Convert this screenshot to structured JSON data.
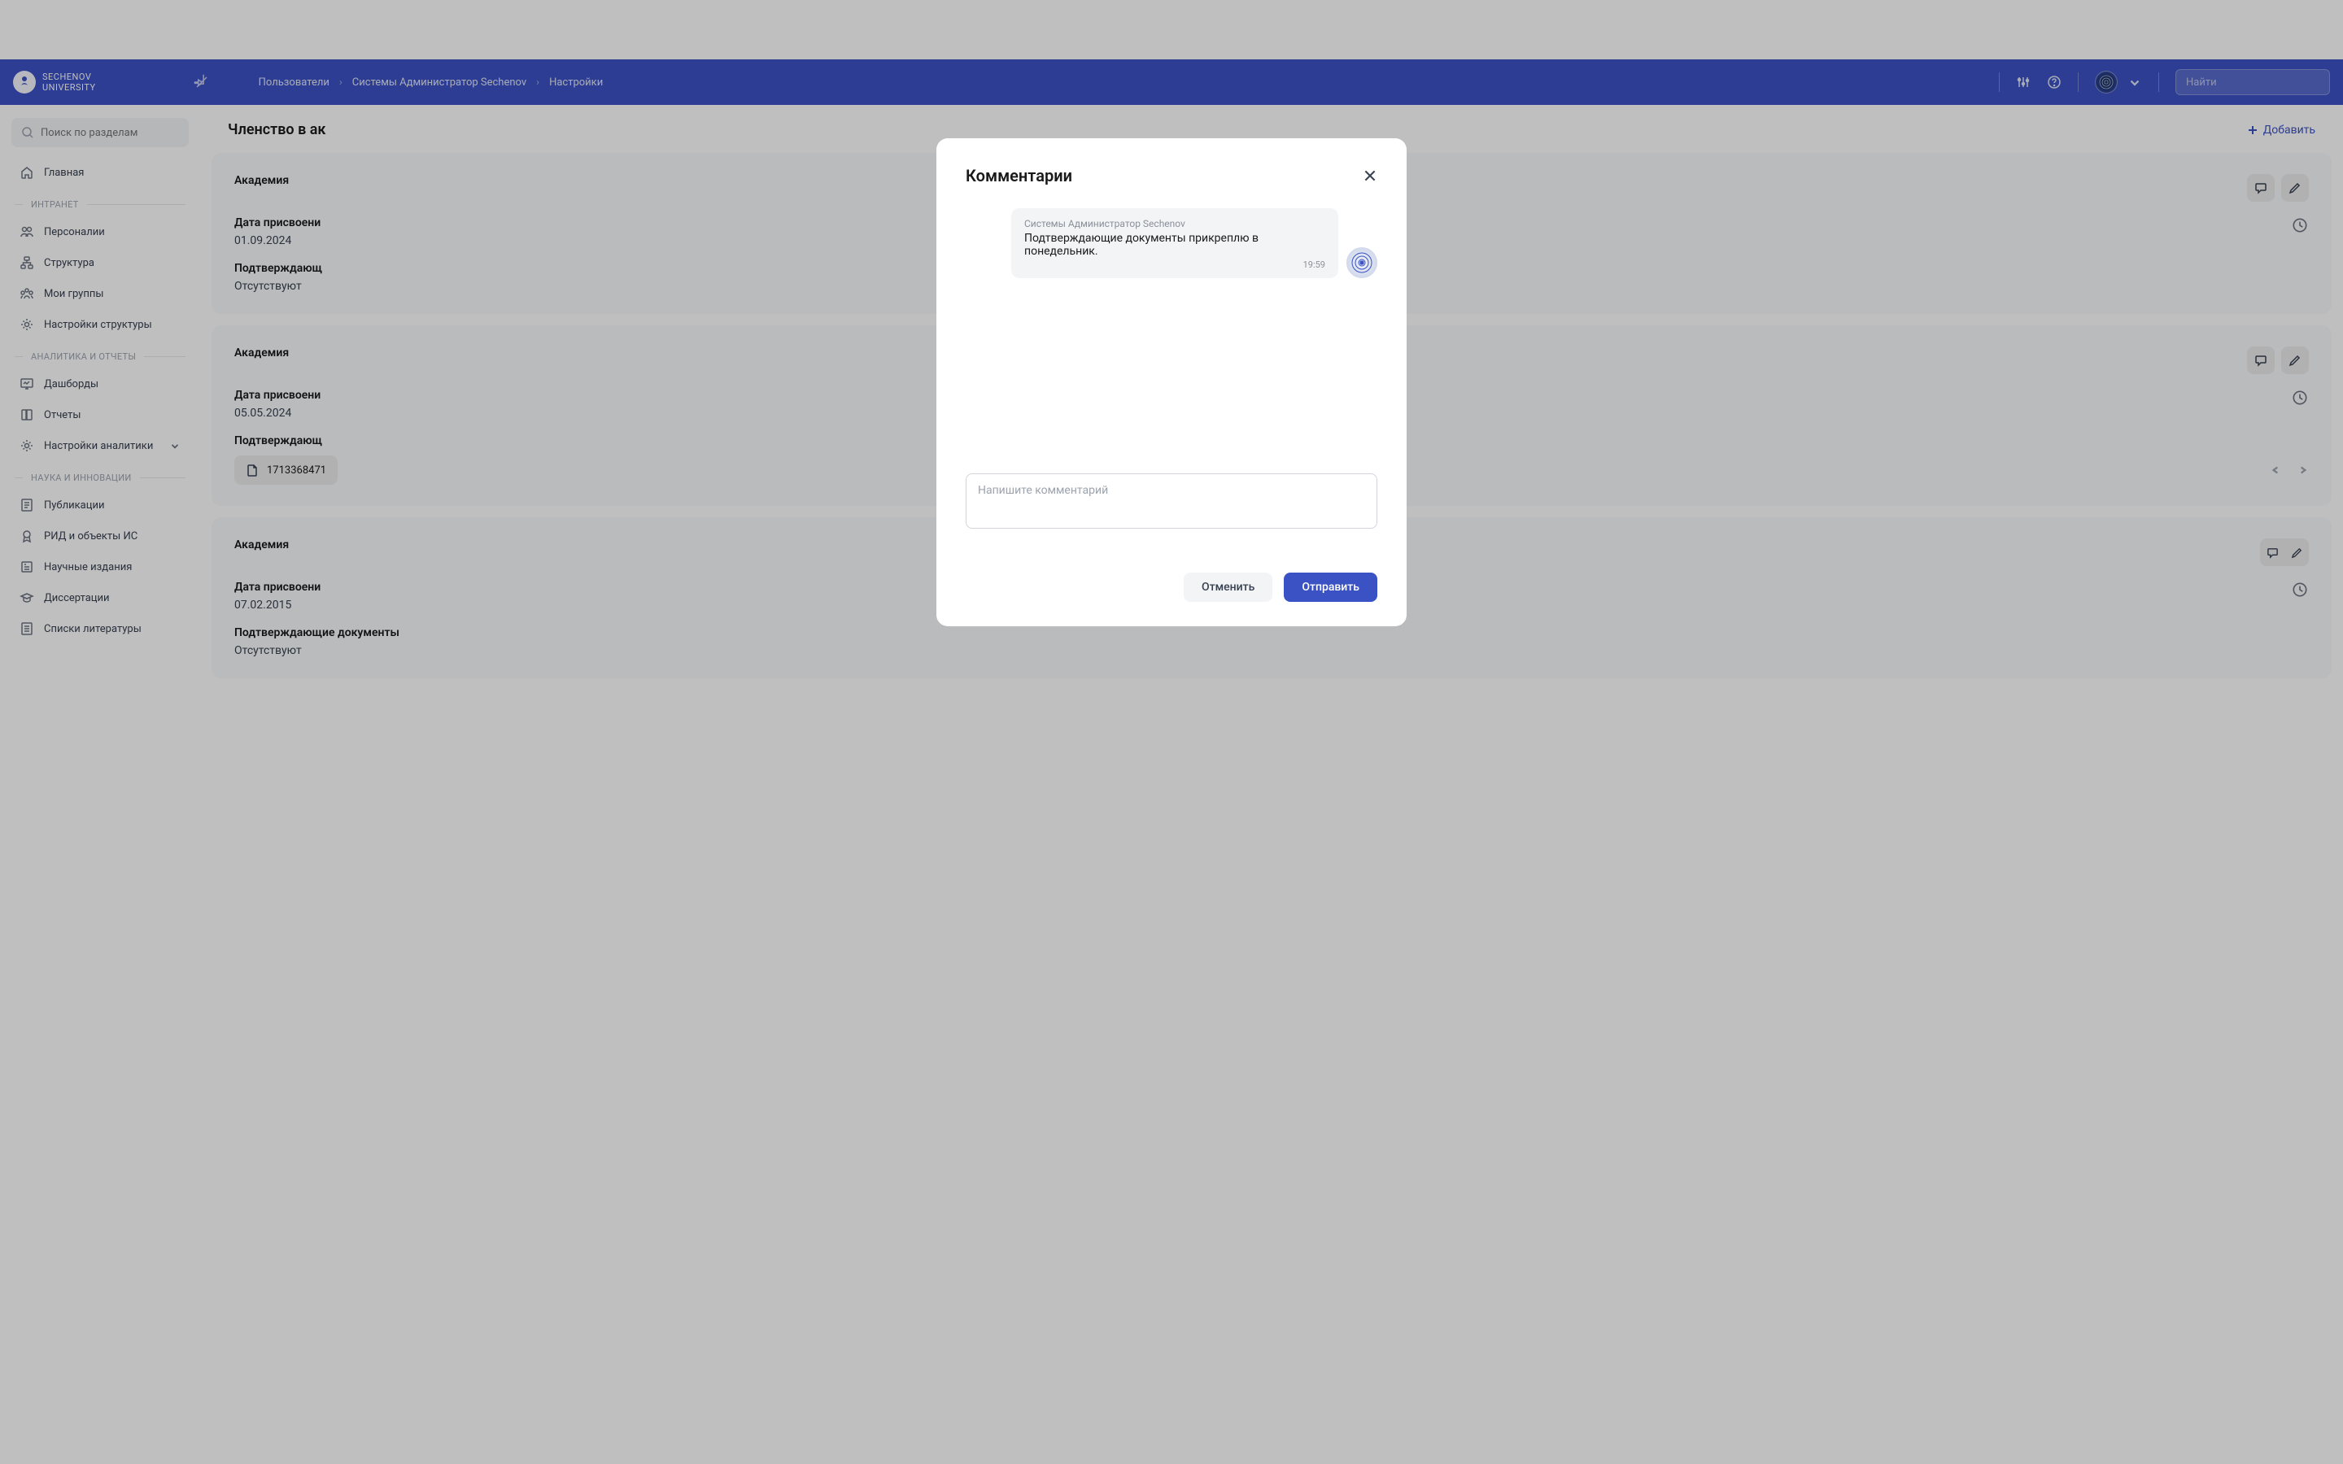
{
  "header": {
    "logo_line1": "SECHENOV",
    "logo_line2": "UNIVERSITY",
    "breadcrumb": [
      "Пользователи",
      "Системы Администратор Sechenov",
      "Настройки"
    ],
    "search_placeholder": "Найти"
  },
  "sidebar": {
    "search_placeholder": "Поиск по разделам",
    "home": "Главная",
    "sections": [
      {
        "title": "ИНТРАНЕТ",
        "items": [
          "Персоналии",
          "Структура",
          "Мои группы",
          "Настройки структуры"
        ]
      },
      {
        "title": "АНАЛИТИКА И ОТЧЕТЫ",
        "items": [
          "Дашборды",
          "Отчеты",
          "Настройки аналитики"
        ]
      },
      {
        "title": "НАУКА И ИННОВАЦИИ",
        "items": [
          "Публикации",
          "РИД и объекты ИС",
          "Научные издания",
          "Диссертации",
          "Списки литературы"
        ]
      }
    ]
  },
  "main": {
    "section_title": "Членство в ак",
    "add_label": "Добавить",
    "cards": [
      {
        "title": "Академия",
        "date_label": "Дата присвоени",
        "date_value": "01.09.2024",
        "docs_label": "Подтверждающ",
        "docs_value": "Отсутствуют"
      },
      {
        "title": "Академия",
        "date_label": "Дата присвоени",
        "date_value": "05.05.2024",
        "docs_label": "Подтверждающ",
        "doc_file": "1713368471"
      },
      {
        "title": "Академия",
        "date_label": "Дата присвоени",
        "date_value": "07.02.2015",
        "docs_label": "Подтверждающие документы",
        "docs_value": "Отсутствуют"
      }
    ]
  },
  "modal": {
    "title": "Комментарии",
    "comment": {
      "author": "Системы Администратор Sechenov",
      "text": "Подтверждающие документы прикреплю в понедельник.",
      "time": "19:59"
    },
    "input_placeholder": "Напишите комментарий",
    "cancel": "Отменить",
    "submit": "Отправить"
  }
}
